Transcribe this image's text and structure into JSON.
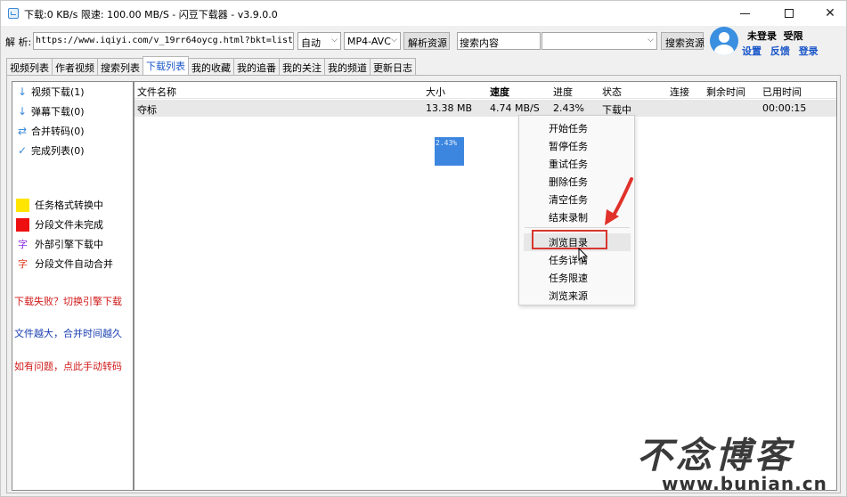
{
  "window": {
    "title": "下载:0 KB/s  限速: 100.00 MB/S  - 闪豆下载器 - v3.9.0.0"
  },
  "toolbar": {
    "parse_label": "解 析:",
    "url_value": "https://www.iqiyi.com/v_19rr64oycg.html?bkt=list_main",
    "quality_value": "自动",
    "format_value": "MP4-AVC",
    "parse_button": "解析资源",
    "search_value": "搜索内容",
    "search_combo_value": "",
    "search_button": "搜索资源"
  },
  "account": {
    "status": "未登录",
    "privilege": "受限",
    "settings": "设置",
    "feedback": "反馈",
    "login": "登录"
  },
  "tabs": [
    {
      "label": "视频列表"
    },
    {
      "label": "作者视频"
    },
    {
      "label": "搜索列表"
    },
    {
      "label": "下载列表",
      "active": true
    },
    {
      "label": "我的收藏"
    },
    {
      "label": "我的追番"
    },
    {
      "label": "我的关注"
    },
    {
      "label": "我的频道"
    },
    {
      "label": "更新日志"
    }
  ],
  "sidebar": {
    "items": [
      {
        "icon": "download-arrow-icon",
        "label": "视频下载(1)"
      },
      {
        "icon": "download-arrow-icon",
        "label": "弹幕下载(0)"
      },
      {
        "icon": "merge-arrows-icon",
        "label": "合并转码(0)"
      },
      {
        "icon": "checkmark-icon",
        "label": "完成列表(0)"
      }
    ],
    "legend": [
      {
        "kind": "swatch",
        "color": "#ffe500",
        "label": "任务格式转换中"
      },
      {
        "kind": "swatch",
        "color": "#ee1010",
        "label": "分段文件未完成"
      },
      {
        "kind": "glyph",
        "glyph": "字",
        "color": "#8a2be2",
        "label": "外部引擎下载中"
      },
      {
        "kind": "glyph",
        "glyph": "字",
        "color": "#e03a20",
        "label": "分段文件自动合并"
      }
    ],
    "notes": [
      {
        "text": "下载失败？切换引擎下载",
        "color": "#d01818"
      },
      {
        "text": "文件越大，合并时间越久",
        "color": "#1a3fb0"
      },
      {
        "text": "如有问题，点此手动转码",
        "color": "#d01818"
      }
    ]
  },
  "download_list": {
    "columns": [
      "文件名称",
      "大小",
      "速度",
      "进度",
      "状态",
      "连接",
      "剩余时间",
      "已用时间"
    ],
    "rows": [
      {
        "name": "夺标",
        "size": "13.38 MB",
        "speed": "4.74 MB/S",
        "progress": "2.43%",
        "status": "下载中",
        "connections": "",
        "remaining": "",
        "elapsed": "00:00:15"
      }
    ],
    "progress_overlay": "2.43%"
  },
  "context_menu": {
    "items": [
      "开始任务",
      "暂停任务",
      "重试任务",
      "删除任务",
      "清空任务",
      "结束录制",
      "浏览目录",
      "任务详情",
      "任务限速",
      "浏览来源"
    ],
    "highlighted": "浏览目录",
    "highlight_color": "#d7362e"
  },
  "watermark": {
    "brand": "不念博客",
    "url": "www.bunian.cn"
  }
}
